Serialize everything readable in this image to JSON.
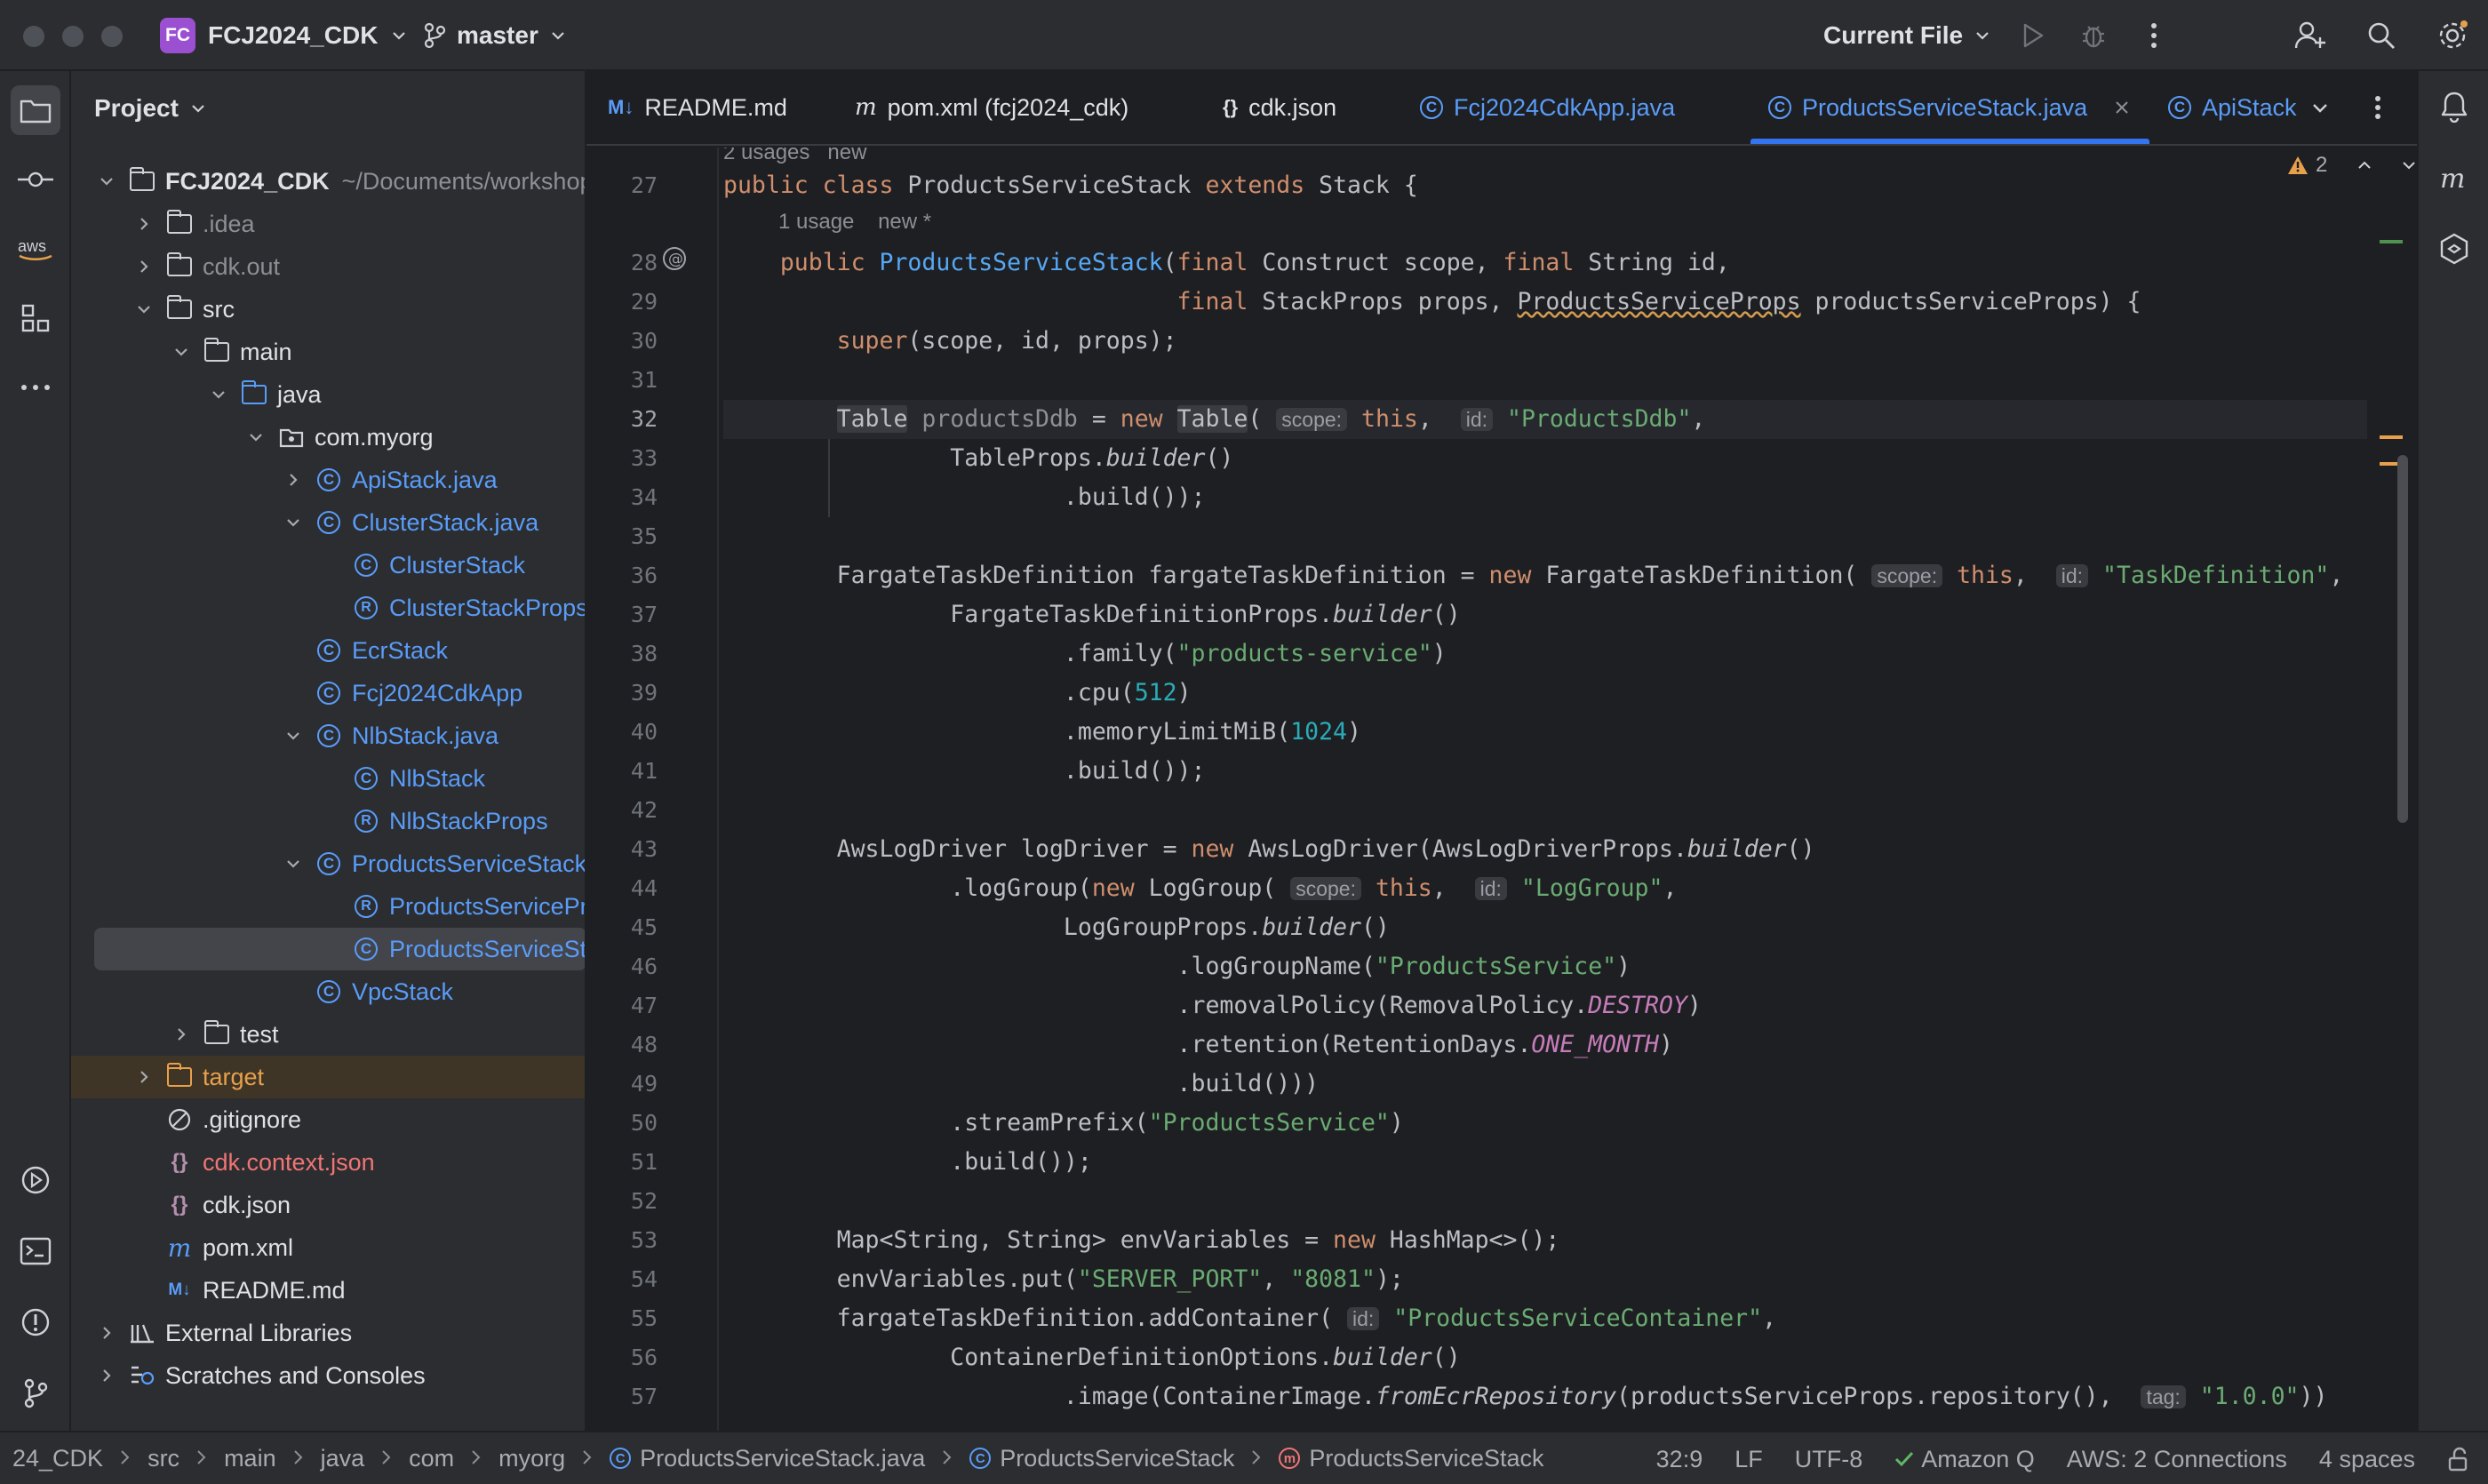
{
  "titlebar": {
    "project_badge": "FC",
    "project_name": "FCJ2024_CDK",
    "branch": "master",
    "run_config": "Current File"
  },
  "project_panel": {
    "title": "Project",
    "tree": [
      {
        "label": "FCJ2024_CDK",
        "suffix": "~/Documents/workshop",
        "depth": 0,
        "expanded": true,
        "icon": "module-folder-icon",
        "style": "bold"
      },
      {
        "label": ".idea",
        "depth": 1,
        "expanded": false,
        "icon": "folder-icon",
        "style": "gray"
      },
      {
        "label": "cdk.out",
        "depth": 1,
        "expanded": false,
        "icon": "folder-icon",
        "style": "gray"
      },
      {
        "label": "src",
        "depth": 1,
        "expanded": true,
        "icon": "folder-icon",
        "style": "default"
      },
      {
        "label": "main",
        "depth": 2,
        "expanded": true,
        "icon": "folder-icon",
        "style": "default"
      },
      {
        "label": "java",
        "depth": 3,
        "expanded": true,
        "icon": "source-folder-icon",
        "style": "default"
      },
      {
        "label": "com.myorg",
        "depth": 4,
        "expanded": true,
        "icon": "package-icon",
        "style": "default"
      },
      {
        "label": "ApiStack.java",
        "depth": 5,
        "expanded": false,
        "icon": "class-icon",
        "style": "blue"
      },
      {
        "label": "ClusterStack.java",
        "depth": 5,
        "expanded": true,
        "icon": "class-icon",
        "style": "blue"
      },
      {
        "label": "ClusterStack",
        "depth": 6,
        "icon": "class-icon",
        "style": "blue"
      },
      {
        "label": "ClusterStackProps",
        "depth": 6,
        "icon": "record-icon",
        "style": "blue"
      },
      {
        "label": "EcrStack",
        "depth": 5,
        "icon": "class-icon",
        "style": "blue"
      },
      {
        "label": "Fcj2024CdkApp",
        "depth": 5,
        "icon": "class-icon",
        "style": "blue"
      },
      {
        "label": "NlbStack.java",
        "depth": 5,
        "expanded": true,
        "icon": "class-icon",
        "style": "blue"
      },
      {
        "label": "NlbStack",
        "depth": 6,
        "icon": "class-icon",
        "style": "blue"
      },
      {
        "label": "NlbStackProps",
        "depth": 6,
        "icon": "record-icon",
        "style": "blue"
      },
      {
        "label": "ProductsServiceStack.java",
        "depth": 5,
        "expanded": true,
        "icon": "class-icon",
        "style": "blue"
      },
      {
        "label": "ProductsServiceProps",
        "depth": 6,
        "icon": "record-icon",
        "style": "blue"
      },
      {
        "label": "ProductsServiceStack",
        "depth": 6,
        "icon": "class-icon",
        "style": "blue",
        "selected": true
      },
      {
        "label": "VpcStack",
        "depth": 5,
        "icon": "class-icon",
        "style": "blue"
      },
      {
        "label": "test",
        "depth": 2,
        "expanded": false,
        "icon": "folder-icon",
        "style": "default"
      },
      {
        "label": "target",
        "depth": 1,
        "expanded": false,
        "icon": "folder-icon",
        "style": "orange",
        "excluded": true
      },
      {
        "label": ".gitignore",
        "depth": 1,
        "icon": "ignore-file-icon",
        "style": "default"
      },
      {
        "label": "cdk.context.json",
        "depth": 1,
        "icon": "json-icon",
        "style": "red"
      },
      {
        "label": "cdk.json",
        "depth": 1,
        "icon": "json-icon",
        "style": "default"
      },
      {
        "label": "pom.xml",
        "depth": 1,
        "icon": "maven-icon",
        "style": "default"
      },
      {
        "label": "README.md",
        "depth": 1,
        "icon": "markdown-icon",
        "style": "default"
      },
      {
        "label": "External Libraries",
        "depth": 0,
        "expanded": false,
        "icon": "libraries-icon",
        "style": "default"
      },
      {
        "label": "Scratches and Consoles",
        "depth": 0,
        "expanded": false,
        "icon": "scratches-icon",
        "style": "default"
      }
    ]
  },
  "tabs": [
    {
      "label": "README.md",
      "icon": "M↓",
      "color": "#5a9cf8",
      "icon_name": "markdown-icon"
    },
    {
      "label": "pom.xml (fcj2024_cdk)",
      "icon": "m",
      "color": "#dfe1e5",
      "icon_name": "maven-icon"
    },
    {
      "label": "cdk.json",
      "icon": "{}",
      "color": "#dfe1e5",
      "icon_name": "json-icon"
    },
    {
      "label": "Fcj2024CdkApp.java",
      "icon": "C",
      "color": "#5a9cf8",
      "icon_name": "class-icon"
    },
    {
      "label": "ProductsServiceStack.java",
      "icon": "C",
      "color": "#5a9cf8",
      "icon_name": "class-icon",
      "active": true
    },
    {
      "label": "ApiStack",
      "icon": "C",
      "color": "#5a9cf8",
      "icon_name": "class-icon"
    }
  ],
  "editor": {
    "warnings_count": "2",
    "usages_top": "2 usages   new",
    "usages_ctor": "1 usage    new *",
    "current_line": 32,
    "lines": [
      {
        "n": 27,
        "html": "<span class='kw'>public class </span>ProductsServiceStack <span class='kw'>extends </span>Stack {"
      },
      {
        "n": 28,
        "html": "    <span class='kw'>public </span><span class='fn'>ProductsServiceStack</span>(<span class='kw'>final </span>Construct scope, <span class='kw'>final </span>String id,"
      },
      {
        "n": 29,
        "html": "                                <span class='kw'>final </span>StackProps props, <span class='ul'>ProductsServiceProps</span> productsServiceProps) {"
      },
      {
        "n": 30,
        "html": "        <span class='kw'>super</span>(scope, id, props);"
      },
      {
        "n": 31,
        "html": ""
      },
      {
        "n": 32,
        "html": "        <span class='hl'>Table</span> <span class='t-gray'>productsDdb</span> = <span class='kw'>new </span><span class='hl'>Table</span>( <span class='hint'>scope:</span> <span class='kw'>this</span>,  <span class='hint'>id:</span> <span class='str'>\"ProductsDdb\"</span>,"
      },
      {
        "n": 33,
        "html": "                TableProps.<span class='it'>builder</span>()"
      },
      {
        "n": 34,
        "html": "                        .build());"
      },
      {
        "n": 35,
        "html": ""
      },
      {
        "n": 36,
        "html": "        FargateTaskDefinition fargateTaskDefinition = <span class='kw'>new </span>FargateTaskDefinition( <span class='hint'>scope:</span> <span class='kw'>this</span>,  <span class='hint'>id:</span> <span class='str'>\"TaskDefinition\"</span>,"
      },
      {
        "n": 37,
        "html": "                FargateTaskDefinitionProps.<span class='it'>builder</span>()"
      },
      {
        "n": 38,
        "html": "                        .family(<span class='str'>\"products-service\"</span>)"
      },
      {
        "n": 39,
        "html": "                        .cpu(<span class='num'>512</span>)"
      },
      {
        "n": 40,
        "html": "                        .memoryLimitMiB(<span class='num'>1024</span>)"
      },
      {
        "n": 41,
        "html": "                        .build());"
      },
      {
        "n": 42,
        "html": ""
      },
      {
        "n": 43,
        "html": "        AwsLogDriver logDriver = <span class='kw'>new </span>AwsLogDriver(AwsLogDriverProps.<span class='it'>builder</span>()"
      },
      {
        "n": 44,
        "html": "                .logGroup(<span class='kw'>new </span>LogGroup( <span class='hint'>scope:</span> <span class='kw'>this</span>,  <span class='hint'>id:</span> <span class='str'>\"LogGroup\"</span>,"
      },
      {
        "n": 45,
        "html": "                        LogGroupProps.<span class='it'>builder</span>()"
      },
      {
        "n": 46,
        "html": "                                .logGroupName(<span class='str'>\"ProductsService\"</span>)"
      },
      {
        "n": 47,
        "html": "                                .removalPolicy(RemovalPolicy.<span class='st'>DESTROY</span>)"
      },
      {
        "n": 48,
        "html": "                                .retention(RetentionDays.<span class='st'>ONE_MONTH</span>)"
      },
      {
        "n": 49,
        "html": "                                .build()))"
      },
      {
        "n": 50,
        "html": "                .streamPrefix(<span class='str'>\"ProductsService\"</span>)"
      },
      {
        "n": 51,
        "html": "                .build());"
      },
      {
        "n": 52,
        "html": ""
      },
      {
        "n": 53,
        "html": "        Map&lt;String, String&gt; envVariables = <span class='kw'>new </span>HashMap&lt;&gt;();"
      },
      {
        "n": 54,
        "html": "        envVariables.put(<span class='str'>\"SERVER_PORT\"</span>, <span class='str'>\"8081\"</span>);"
      },
      {
        "n": 55,
        "html": "        fargateTaskDefinition.addContainer( <span class='hint'>id:</span> <span class='str'>\"ProductsServiceContainer\"</span>,"
      },
      {
        "n": 56,
        "html": "                ContainerDefinitionOptions.<span class='it'>builder</span>()"
      },
      {
        "n": 57,
        "html": "                        .image(ContainerImage.<span class='it'>fromEcrRepository</span>(productsServiceProps.repository(),  <span class='hint'>tag:</span> <span class='str'>\"1.0.0\"</span>))"
      }
    ]
  },
  "statusbar": {
    "breadcrumbs": [
      "24_CDK",
      "src",
      "main",
      "java",
      "com",
      "myorg",
      "ProductsServiceStack.java",
      "ProductsServiceStack",
      "ProductsServiceStack"
    ],
    "position": "32:9",
    "line_sep": "LF",
    "encoding": "UTF-8",
    "amazon_q": "Amazon Q",
    "aws": "AWS: 2 Connections",
    "indent": "4 spaces"
  },
  "colors": {
    "accent": "#3574f0",
    "class_blue": "#5a9cf8",
    "excluded_orange": "#e8a04b",
    "error_red": "#f07575"
  }
}
